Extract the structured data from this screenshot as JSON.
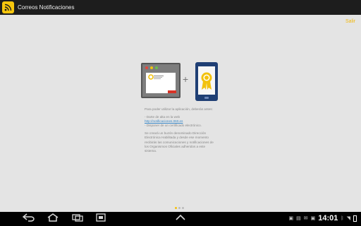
{
  "app_bar": {
    "title": "Correos Notificaciones"
  },
  "actions": {
    "salir": "Salir"
  },
  "intro": {
    "line1": "Para poder utilizar la aplicación, deberás antes:",
    "bullet1_prefix": "- Darte de alta en la web ",
    "bullet1_link": "http://notificaciones.060.es",
    "bullet2": "- Disponer de un certificado electrónico.",
    "paragraph": "Se creará un buzón denominado Dirección Electrónica Habilitada y desde ese momento recibirás las comunicaciones y notificaciones de los Organismos Oficiales adheridos a este sistema."
  },
  "status_bar": {
    "time": "14:01"
  },
  "colors": {
    "accent": "#f6c60d",
    "phone": "#1f3f74",
    "app_bar": "#1d1d1d"
  },
  "icons": [
    "app-rss-icon",
    "browser-illustration-icon",
    "phone-certificate-icon",
    "back-icon",
    "home-icon",
    "recents-icon",
    "screenshot-icon",
    "up-chevron-icon",
    "wifi-icon",
    "battery-icon"
  ]
}
